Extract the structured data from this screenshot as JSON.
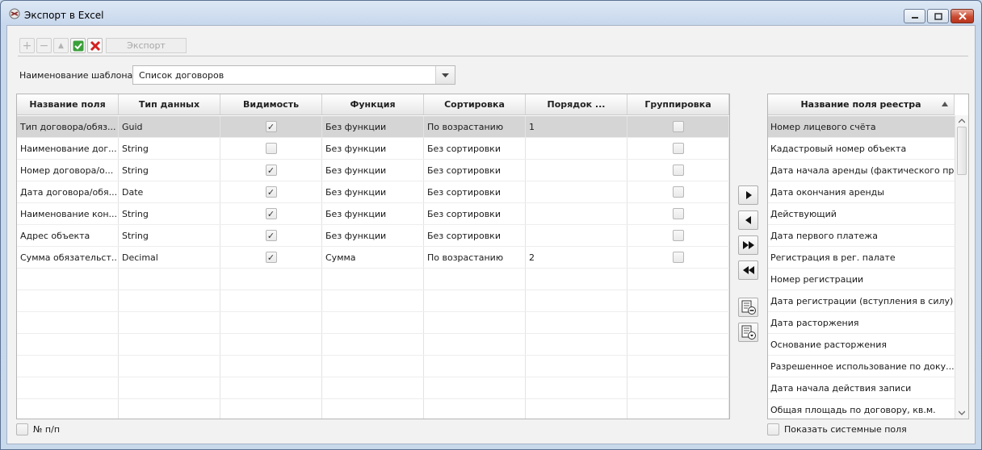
{
  "window": {
    "title": "Экспорт в Excel"
  },
  "toolbar": {
    "export_label": "Экспорт"
  },
  "template": {
    "label": "Наименование шаблона",
    "value": "Список договоров"
  },
  "grid": {
    "columns": [
      "Название поля",
      "Тип данных",
      "Видимость",
      "Функция",
      "Сортировка",
      "Порядок ...",
      "Группировка"
    ],
    "rows": [
      {
        "name": "Тип договора/обяз...",
        "type": "Guid",
        "visible": true,
        "func": "Без функции",
        "sort": "По возрастанию",
        "order": "1",
        "group": false
      },
      {
        "name": "Наименование дог...",
        "type": "String",
        "visible": false,
        "func": "Без функции",
        "sort": "Без сортировки",
        "order": "",
        "group": false
      },
      {
        "name": "Номер договора/о...",
        "type": "String",
        "visible": true,
        "func": "Без функции",
        "sort": "Без сортировки",
        "order": "",
        "group": false
      },
      {
        "name": "Дата договора/обя...",
        "type": "Date",
        "visible": true,
        "func": "Без функции",
        "sort": "Без сортировки",
        "order": "",
        "group": false
      },
      {
        "name": "Наименование кон...",
        "type": "String",
        "visible": true,
        "func": "Без функции",
        "sort": "Без сортировки",
        "order": "",
        "group": false
      },
      {
        "name": "Адрес объекта",
        "type": "String",
        "visible": true,
        "func": "Без функции",
        "sort": "Без сортировки",
        "order": "",
        "group": false
      },
      {
        "name": "Сумма обязательст...",
        "type": "Decimal",
        "visible": true,
        "func": "Сумма",
        "sort": "По возрастанию",
        "order": "2",
        "group": false
      }
    ]
  },
  "registry": {
    "header": "Название поля реестра",
    "items": [
      "Номер лицевого счёта",
      "Кадастровый номер объекта",
      "Дата начала аренды (фактического пр...",
      "Дата окончания аренды",
      "Действующий",
      "Дата первого платежа",
      "Регистрация в рег. палате",
      "Номер регистрации",
      "Дата регистрации (вступления в силу)",
      "Дата расторжения",
      "Основание расторжения",
      "Разрешенное использование по доку...",
      "Дата начала действия записи",
      "Общая площадь по договору, кв.м."
    ]
  },
  "footer": {
    "row_number_label": "№ п/п",
    "show_system_label": "Показать системные поля"
  },
  "icons": [
    "app-icon",
    "minimize-icon",
    "maximize-icon",
    "close-icon",
    "add-icon",
    "remove-icon",
    "up-icon",
    "check-icon",
    "delete-icon",
    "dropdown-arrow-icon",
    "move-right-icon",
    "move-left-icon",
    "move-all-right-icon",
    "move-all-left-icon",
    "save-template-icon",
    "load-template-icon"
  ]
}
